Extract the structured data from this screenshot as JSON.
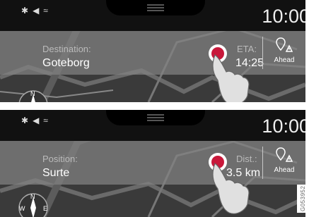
{
  "screens": [
    {
      "time": "10:00",
      "field_label": "Destination:",
      "field_value": "Goteborg",
      "metric_label": "ETA:",
      "metric_value": "14:25",
      "ahead_label": "Ahead"
    },
    {
      "time": "10:00",
      "field_label": "Position:",
      "field_value": "Surte",
      "metric_label": "Dist.:",
      "metric_value": "3.5 km",
      "ahead_label": "Ahead"
    }
  ],
  "compass": {
    "n": "N",
    "w": "W",
    "e": "E"
  },
  "figure_id": "G053952",
  "colors": {
    "touch_ring": "#c8183a",
    "infobar": "#8a8a8a"
  },
  "icons": [
    "bluetooth-icon",
    "navigation-icon",
    "wifi-icon",
    "ahead-icon",
    "compass-icon"
  ]
}
